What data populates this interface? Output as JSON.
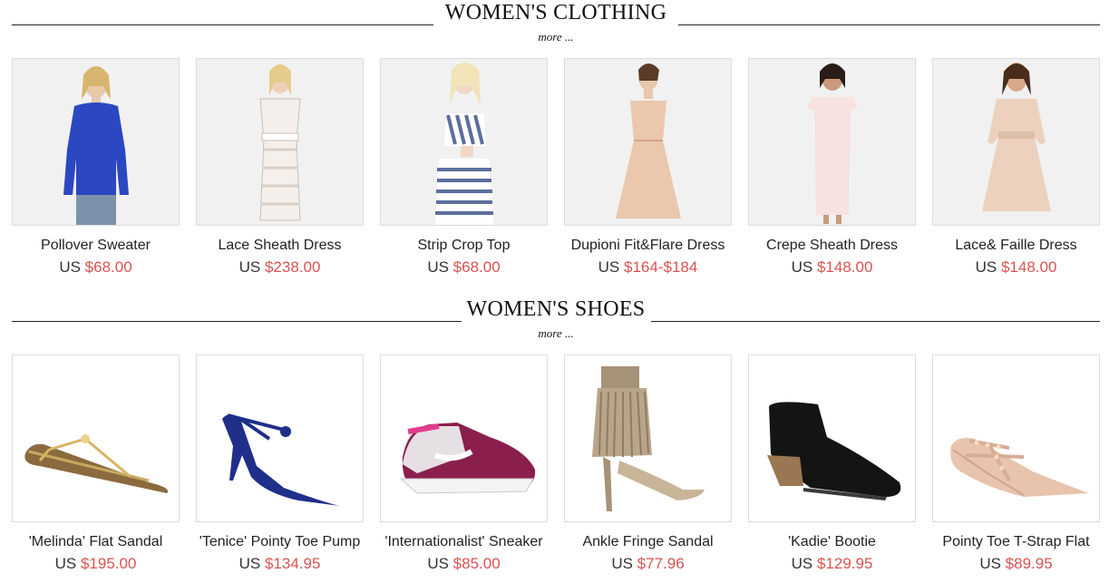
{
  "sections": [
    {
      "title": "WOMEN'S CLOTHING",
      "more": "more ...",
      "products": [
        {
          "name": "Pollover Sweater",
          "currency": "US",
          "price": "$68.00"
        },
        {
          "name": "Lace Sheath Dress",
          "currency": "US",
          "price": "$238.00"
        },
        {
          "name": "Strip Crop Top",
          "currency": "US",
          "price": "$68.00"
        },
        {
          "name": "Dupioni Fit&Flare Dress",
          "currency": "US",
          "price": "$164-$184"
        },
        {
          "name": "Crepe Sheath Dress",
          "currency": "US",
          "price": "$148.00"
        },
        {
          "name": "Lace& Faille Dress",
          "currency": "US",
          "price": "$148.00"
        }
      ]
    },
    {
      "title": "WOMEN'S SHOES",
      "more": "more ...",
      "products": [
        {
          "name": "'Melinda' Flat Sandal",
          "currency": "US",
          "price": "$195.00"
        },
        {
          "name": "'Tenice' Pointy Toe Pump",
          "currency": "US",
          "price": "$134.95"
        },
        {
          "name": "'Internationalist' Sneaker",
          "currency": "US",
          "price": "$85.00"
        },
        {
          "name": "Ankle Fringe Sandal",
          "currency": "US",
          "price": "$77.96"
        },
        {
          "name": "'Kadie' Bootie",
          "currency": "US",
          "price": "$129.95"
        },
        {
          "name": "Pointy Toe T-Strap Flat",
          "currency": "US",
          "price": "$89.95"
        }
      ]
    }
  ],
  "colors": {
    "price": "#d9534f",
    "text": "#222222",
    "rule": "#222222",
    "thumb_bg": "#f1f1f1"
  }
}
